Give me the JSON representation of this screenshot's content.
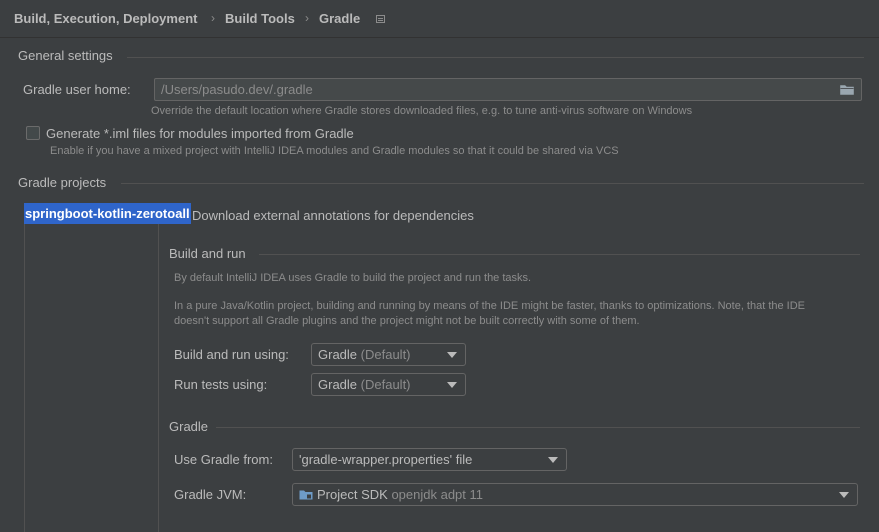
{
  "breadcrumb": {
    "items": [
      "Build, Execution, Deployment",
      "Build Tools",
      "Gradle"
    ],
    "separator": "›"
  },
  "general": {
    "title": "General settings",
    "gradle_home_label": "Gradle user home:",
    "gradle_home_value": "/Users/pasudo.dev/.gradle",
    "gradle_home_hint": "Override the default location where Gradle stores downloaded files, e.g. to tune anti-virus software on Windows",
    "iml_checkbox": {
      "checked": false,
      "label": "Generate *.iml files for modules imported from Gradle",
      "hint": "Enable if you have a mixed project with IntelliJ IDEA modules and Gradle modules so that it could be shared via VCS"
    }
  },
  "projects": {
    "title": "Gradle projects",
    "items": [
      "springboot-kotlin-zerotoall"
    ],
    "download_annotations_label": "Download external annotations for dependencies"
  },
  "build_and_run": {
    "title": "Build and run",
    "desc1": "By default IntelliJ IDEA uses Gradle to build the project and run the tasks.",
    "desc2_line1": "In a pure Java/Kotlin project, building and running by means of the IDE might be faster, thanks to optimizations. Note, that the IDE",
    "desc2_line2": "doesn't support all Gradle plugins and the project might not be built correctly with some of them.",
    "build_run_using_label": "Build and run using:",
    "build_run_using_value": "Gradle",
    "build_run_using_suffix": "(Default)",
    "run_tests_using_label": "Run tests using:",
    "run_tests_using_value": "Gradle",
    "run_tests_using_suffix": "(Default)"
  },
  "gradle": {
    "title": "Gradle",
    "use_gradle_from_label": "Use Gradle from:",
    "use_gradle_from_value": "'gradle-wrapper.properties' file",
    "jvm_label": "Gradle JVM:",
    "jvm_value": "Project SDK",
    "jvm_detail": "openjdk adpt 11"
  },
  "icons": {
    "folder": "folder-icon",
    "layout": "layout-icon",
    "jdk": "sdk-folder-icon",
    "dropdown": "chevron-down-icon"
  }
}
